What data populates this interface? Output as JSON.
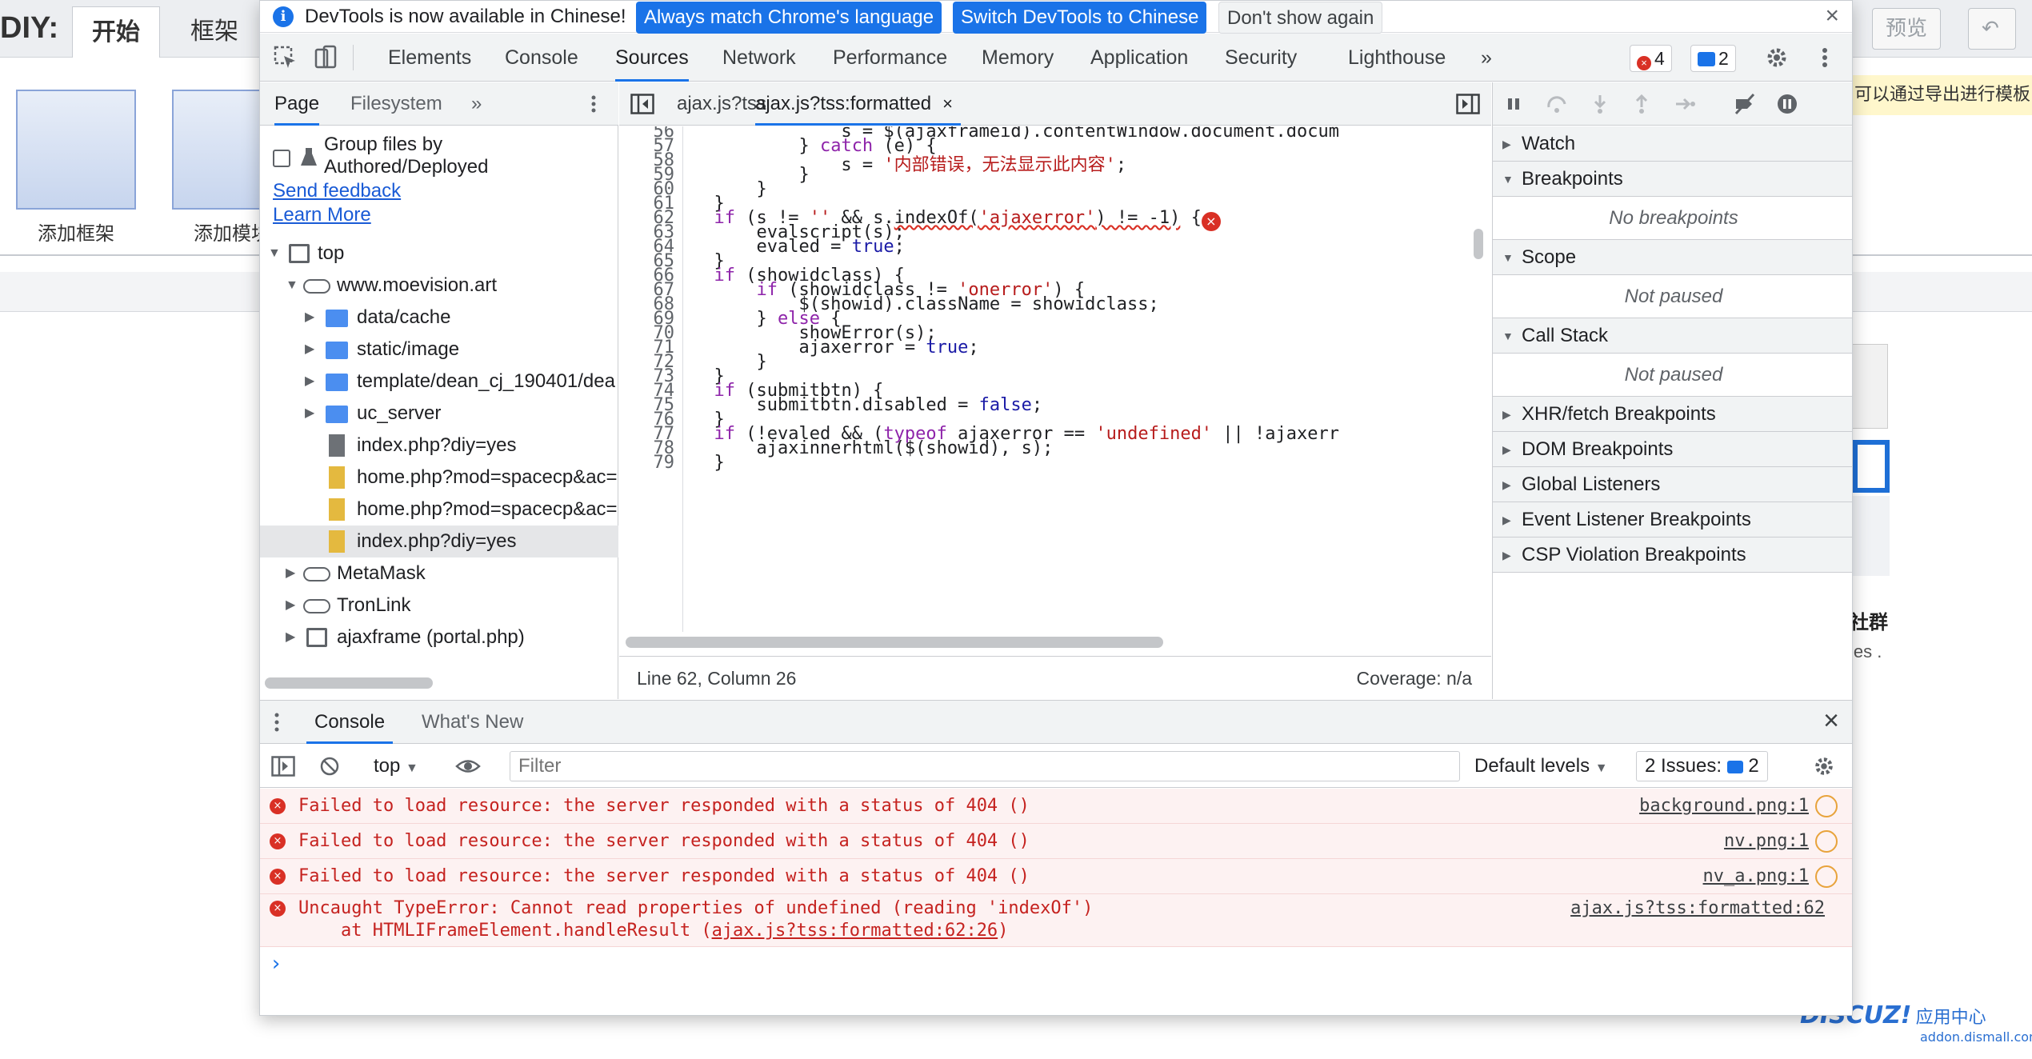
{
  "background": {
    "diy_label": "DIY:",
    "tabs": [
      "开始",
      "框架"
    ],
    "items": [
      "添加框架",
      "添加模块"
    ],
    "right_buttons": [
      "预览"
    ],
    "note": "可以通过导出进行模板",
    "side_title": "社群",
    "side_text": "ies .",
    "watermark_brand": "DISCUZ!",
    "watermark_cn": "应用中心",
    "watermark_url": "addon.dismall.com"
  },
  "infobar": {
    "message": "DevTools is now available in Chinese!",
    "btn_match": "Always match Chrome's language",
    "btn_switch": "Switch DevTools to Chinese",
    "btn_dismiss": "Don't show again",
    "close": "×"
  },
  "main_tabs": [
    "Elements",
    "Console",
    "Sources",
    "Network",
    "Performance",
    "Memory",
    "Application",
    "Security",
    "Lighthouse"
  ],
  "more_tabs": "»",
  "badges": {
    "errors": "4",
    "messages": "2"
  },
  "navigator": {
    "tabs": [
      "Page",
      "Filesystem"
    ],
    "more": "»",
    "group_line1": "Group files by",
    "group_line2": "Authored/Deployed",
    "send_feedback": "Send feedback",
    "learn_more": "Learn More",
    "tree": [
      {
        "label": "top"
      },
      {
        "label": "www.moevision.art"
      },
      {
        "label": "data/cache"
      },
      {
        "label": "static/image"
      },
      {
        "label": "template/dean_cj_190401/dea"
      },
      {
        "label": "uc_server"
      },
      {
        "label": "index.php?diy=yes"
      },
      {
        "label": "home.php?mod=spacecp&ac="
      },
      {
        "label": "home.php?mod=spacecp&ac="
      },
      {
        "label": "index.php?diy=yes"
      },
      {
        "label": "MetaMask"
      },
      {
        "label": "TronLink"
      },
      {
        "label": "ajaxframe (portal.php)"
      }
    ]
  },
  "editor": {
    "tabs": [
      "ajax.js?tss",
      "ajax.js?tss:formatted"
    ],
    "tab_close": "×",
    "status_left": "Line 62, Column 26",
    "status_right": "Coverage: n/a",
    "line_numbers": [
      "56",
      "57",
      "58",
      "59",
      "60",
      "61",
      "62",
      "63",
      "64",
      "65",
      "66",
      "67",
      "68",
      "69",
      "70",
      "71",
      "72",
      "73",
      "74",
      "75",
      "76",
      "77",
      "78",
      "79"
    ]
  },
  "debugger": {
    "sections": {
      "watch": "Watch",
      "breakpoints": "Breakpoints",
      "no_breakpoints": "No breakpoints",
      "scope": "Scope",
      "not_paused_1": "Not paused",
      "call_stack": "Call Stack",
      "not_paused_2": "Not paused",
      "xhr": "XHR/fetch Breakpoints",
      "dom": "DOM Breakpoints",
      "global": "Global Listeners",
      "event": "Event Listener Breakpoints",
      "csp": "CSP Violation Breakpoints"
    }
  },
  "drawer": {
    "tabs": [
      "Console",
      "What's New"
    ],
    "close": "×",
    "context": "top",
    "filter_placeholder": "Filter",
    "levels": "Default levels",
    "issues_label": "2 Issues:",
    "issues_count": "2",
    "messages": [
      {
        "text": "Failed to load resource: the server responded with a status of 404 ()",
        "source": "background.png:1"
      },
      {
        "text": "Failed to load resource: the server responded with a status of 404 ()",
        "source": "nv.png:1"
      },
      {
        "text": "Failed to load resource: the server responded with a status of 404 ()",
        "source": "nv_a.png:1"
      },
      {
        "text": "Uncaught TypeError: Cannot read properties of undefined (reading 'indexOf')",
        "text2_prefix": "    at HTMLIFrameElement.handleResult (",
        "text2_link": "ajax.js?tss:formatted:62:26",
        "text2_suffix": ")",
        "source": "ajax.js?tss:formatted:62"
      }
    ],
    "prompt": "›"
  },
  "colors": {
    "accent": "#1a73e8",
    "error": "#d93025",
    "keyword": "#8e24aa",
    "string": "#b71c1c"
  }
}
